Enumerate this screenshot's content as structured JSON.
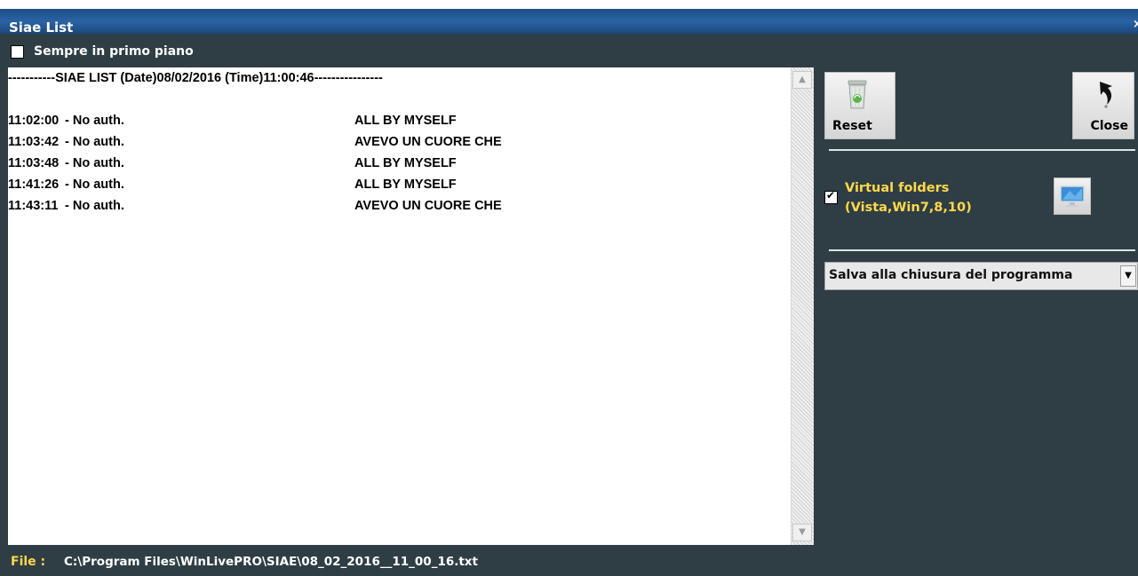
{
  "window": {
    "title": "Siae List",
    "close_glyph": "×"
  },
  "always_on_top": {
    "label": "Sempre in primo piano",
    "checked": false
  },
  "list": {
    "header": "-----------SIAE LIST  (Date)08/02/2016 (Time)11:00:46----------------",
    "entries": [
      {
        "time": "11:02:00",
        "auth": "- No auth.",
        "song": "ALL BY MYSELF"
      },
      {
        "time": "11:03:42",
        "auth": "- No auth.",
        "song": "AVEVO UN CUORE CHE"
      },
      {
        "time": "11:03:48",
        "auth": "- No auth.",
        "song": "ALL BY MYSELF"
      },
      {
        "time": "11:41:26",
        "auth": "- No auth.",
        "song": "ALL BY MYSELF"
      },
      {
        "time": "11:43:11",
        "auth": "- No auth.",
        "song": "AVEVO UN CUORE CHE"
      }
    ]
  },
  "scrollbar": {
    "up_glyph": "▲",
    "down_glyph": "▼"
  },
  "buttons": {
    "reset": {
      "label": "Reset",
      "icon": "recycle-bin-icon"
    },
    "close": {
      "label": "Close",
      "icon": "return-arrow-icon"
    }
  },
  "virtual_folders": {
    "label_line1": "Virtual folders",
    "label_line2": "(Vista,Win7,8,10)",
    "checked": true,
    "check_glyph": "✔",
    "icon": "monitor-icon"
  },
  "save_mode": {
    "selected": "Salva alla chiusura del programma",
    "arrow_glyph": "▼"
  },
  "status": {
    "file_label": "File :",
    "file_path": "C:\\Program Files\\WinLivePRO\\SIAE\\08_02_2016__11_00_16.txt"
  },
  "colors": {
    "panel_bg": "#2f3e45",
    "title_bg": "#1f5089",
    "accent_yellow": "#ffd84a"
  }
}
